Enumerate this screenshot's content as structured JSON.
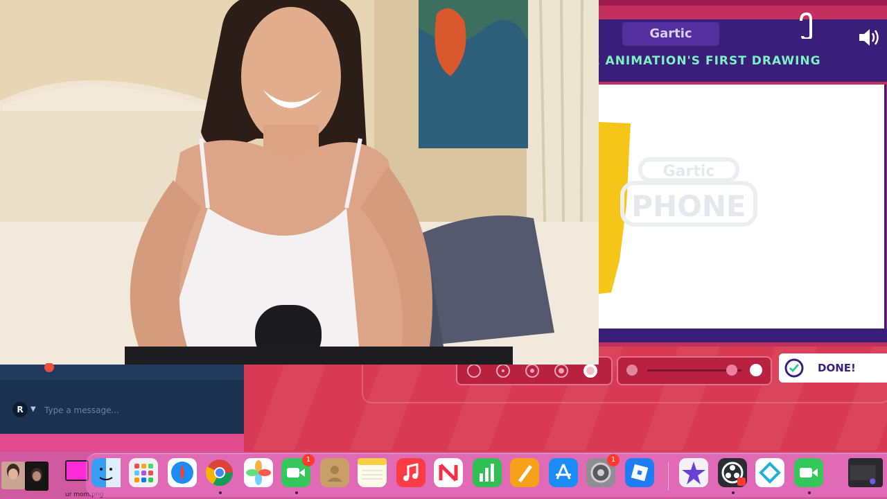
{
  "game": {
    "logo": "Gartic",
    "prompt": "E ANIMATION'S FIRST DRAWING",
    "watermark_line1": "Gartic",
    "watermark_line2": "PHONE",
    "done_label": "DONE!",
    "selected_brush_index": 4,
    "opacity_level": 0.9
  },
  "chat": {
    "avatar_letter": "R",
    "input_placeholder": "Type a message...",
    "input_value": ""
  },
  "desktop": {
    "file_label": "ur mom.png"
  },
  "dock": {
    "items": [
      {
        "name": "Finder",
        "badge": ""
      },
      {
        "name": "Launchpad",
        "badge": ""
      },
      {
        "name": "Safari",
        "badge": ""
      },
      {
        "name": "Chrome",
        "badge": ""
      },
      {
        "name": "Photos",
        "badge": ""
      },
      {
        "name": "FaceTime",
        "badge": "1"
      },
      {
        "name": "Contacts",
        "badge": ""
      },
      {
        "name": "Notes",
        "badge": ""
      },
      {
        "name": "Music",
        "badge": ""
      },
      {
        "name": "News",
        "badge": ""
      },
      {
        "name": "Numbers",
        "badge": ""
      },
      {
        "name": "Pages",
        "badge": ""
      },
      {
        "name": "App Store",
        "badge": ""
      },
      {
        "name": "System Preferences",
        "badge": "1"
      },
      {
        "name": "Roblox",
        "badge": ""
      },
      {
        "name": "iMovie",
        "badge": ""
      },
      {
        "name": "OBS",
        "badge": ""
      },
      {
        "name": "Proxyman",
        "badge": ""
      },
      {
        "name": "FaceTime",
        "badge": ""
      },
      {
        "name": "Screenshot",
        "badge": ""
      }
    ]
  },
  "colors": {
    "game_purple": "#3a1f7a",
    "game_accent_text": "#7ff0c5",
    "background_red": "#d83a55",
    "chat_bg": "#1b3150"
  }
}
